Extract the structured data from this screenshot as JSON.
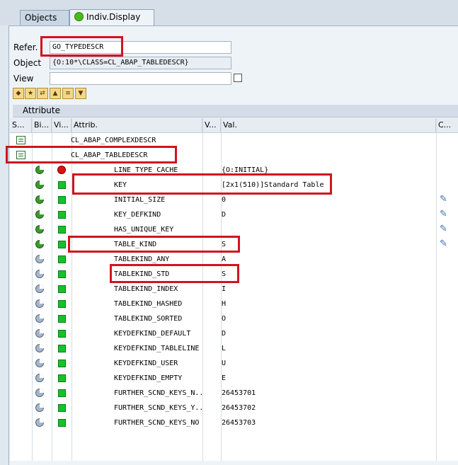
{
  "tabs": {
    "objects": "Objects",
    "indiv": "Indiv.Display"
  },
  "form": {
    "refer_label": "Refer.",
    "refer_value": "GO_TYPEDESCR",
    "object_label": "Object",
    "object_value": "{O:10*\\CLASS=CL_ABAP_TABLEDESCR}",
    "view_label": "View",
    "view_value": ""
  },
  "attribute_bar": "Attribute",
  "columns": {
    "s": "S...",
    "bi": "Bi...",
    "vi": "Vi...",
    "attrib": "Attrib.",
    "v": "V...",
    "val": "Val.",
    "c": "C..."
  },
  "rows": [
    {
      "attrib": "CL_ABAP_COMPLEXDESCR",
      "val": ""
    },
    {
      "attrib": "CL_ABAP_TABLEDESCR",
      "val": ""
    },
    {
      "attrib": "LINE_TYPE_CACHE",
      "val": "{O:INITIAL}"
    },
    {
      "attrib": "KEY",
      "val": "[2x1(510)]Standard Table"
    },
    {
      "attrib": "INITIAL_SIZE",
      "val": "0"
    },
    {
      "attrib": "KEY_DEFKIND",
      "val": "D"
    },
    {
      "attrib": "HAS_UNIQUE_KEY",
      "val": ""
    },
    {
      "attrib": "TABLE_KIND",
      "val": "S"
    },
    {
      "attrib": "TABLEKIND_ANY",
      "val": "A"
    },
    {
      "attrib": "TABLEKIND_STD",
      "val": "S"
    },
    {
      "attrib": "TABLEKIND_INDEX",
      "val": "I"
    },
    {
      "attrib": "TABLEKIND_HASHED",
      "val": "H"
    },
    {
      "attrib": "TABLEKIND_SORTED",
      "val": "O"
    },
    {
      "attrib": "KEYDEFKIND_DEFAULT",
      "val": "D"
    },
    {
      "attrib": "KEYDEFKIND_TABLELINE",
      "val": "L"
    },
    {
      "attrib": "KEYDEFKIND_USER",
      "val": "U"
    },
    {
      "attrib": "KEYDEFKIND_EMPTY",
      "val": "E"
    },
    {
      "attrib": "FURTHER_SCND_KEYS_N...",
      "val": "26453701"
    },
    {
      "attrib": "FURTHER_SCND_KEYS_Y...",
      "val": "26453702"
    },
    {
      "attrib": "FURTHER_SCND_KEYS_NO",
      "val": "26453703"
    }
  ],
  "colors": {
    "highlight": "#d0141e",
    "visible_ok": "#16c12a",
    "visible_err": "#e21010"
  }
}
